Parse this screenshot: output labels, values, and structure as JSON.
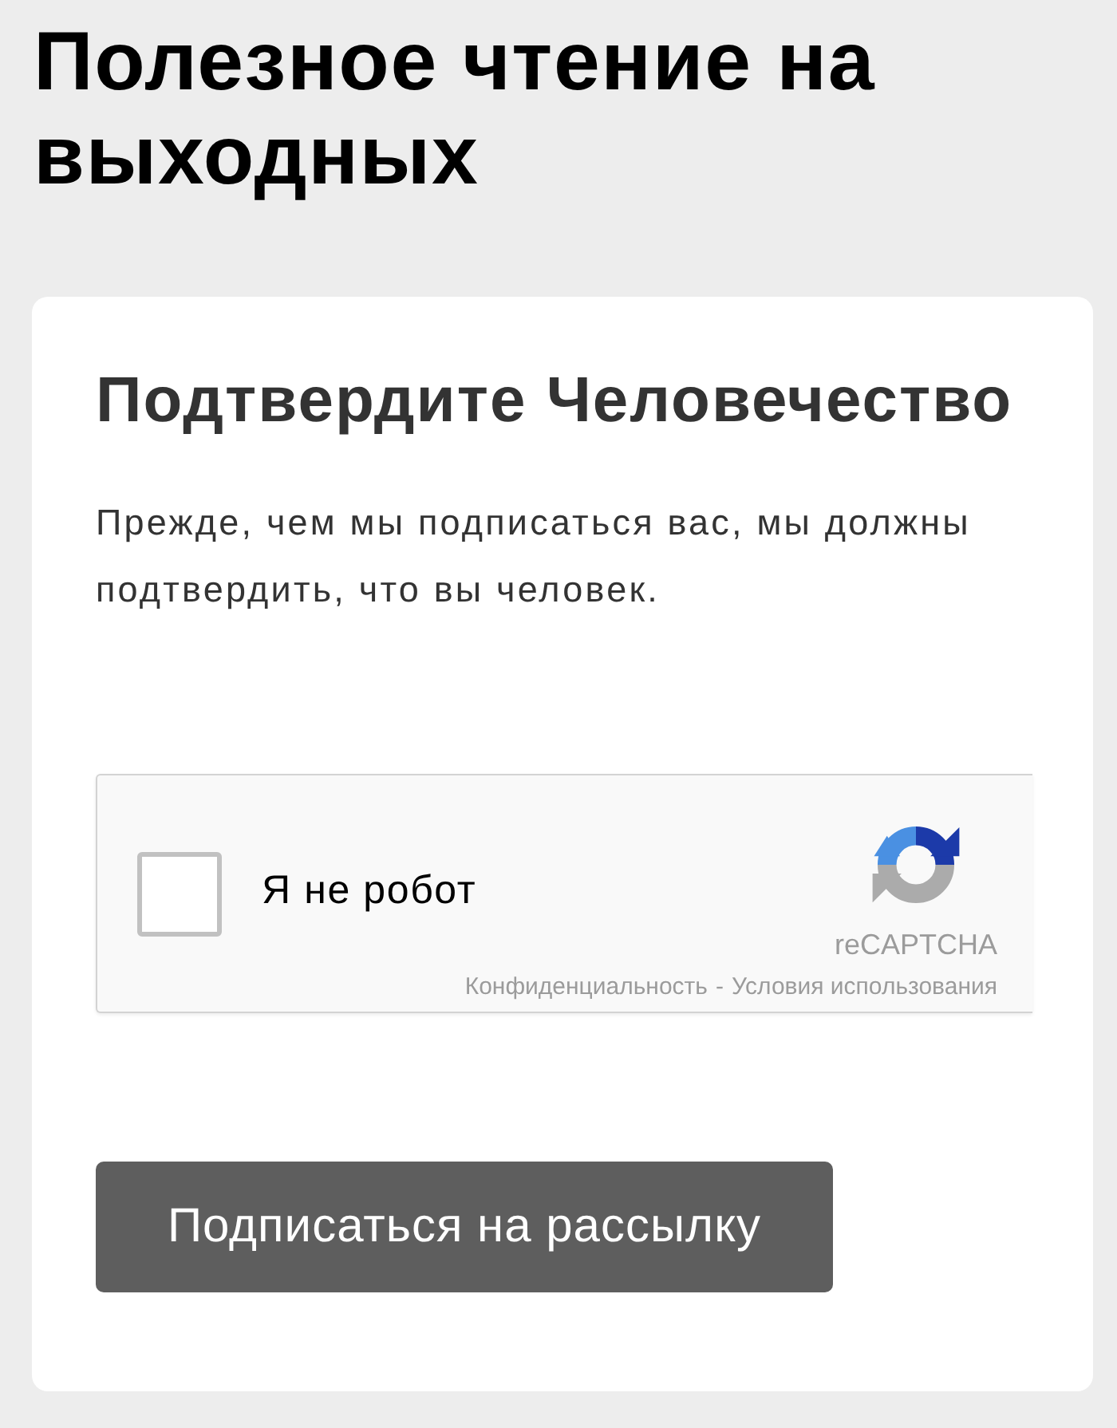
{
  "page_title": "Полезное чтение на выходных",
  "card": {
    "heading": "Подтвердите Человечество",
    "text": "Прежде, чем мы подписаться вас, мы должны подтвердить, что вы человек.",
    "captcha": {
      "checked": false,
      "label": "Я не робот",
      "brand": "reCAPTCHA",
      "links": [
        {
          "label": "Конфиденциальность"
        },
        {
          "label": "Условия использования"
        }
      ],
      "separator": "-"
    },
    "button": "Подписаться на рассылку"
  }
}
